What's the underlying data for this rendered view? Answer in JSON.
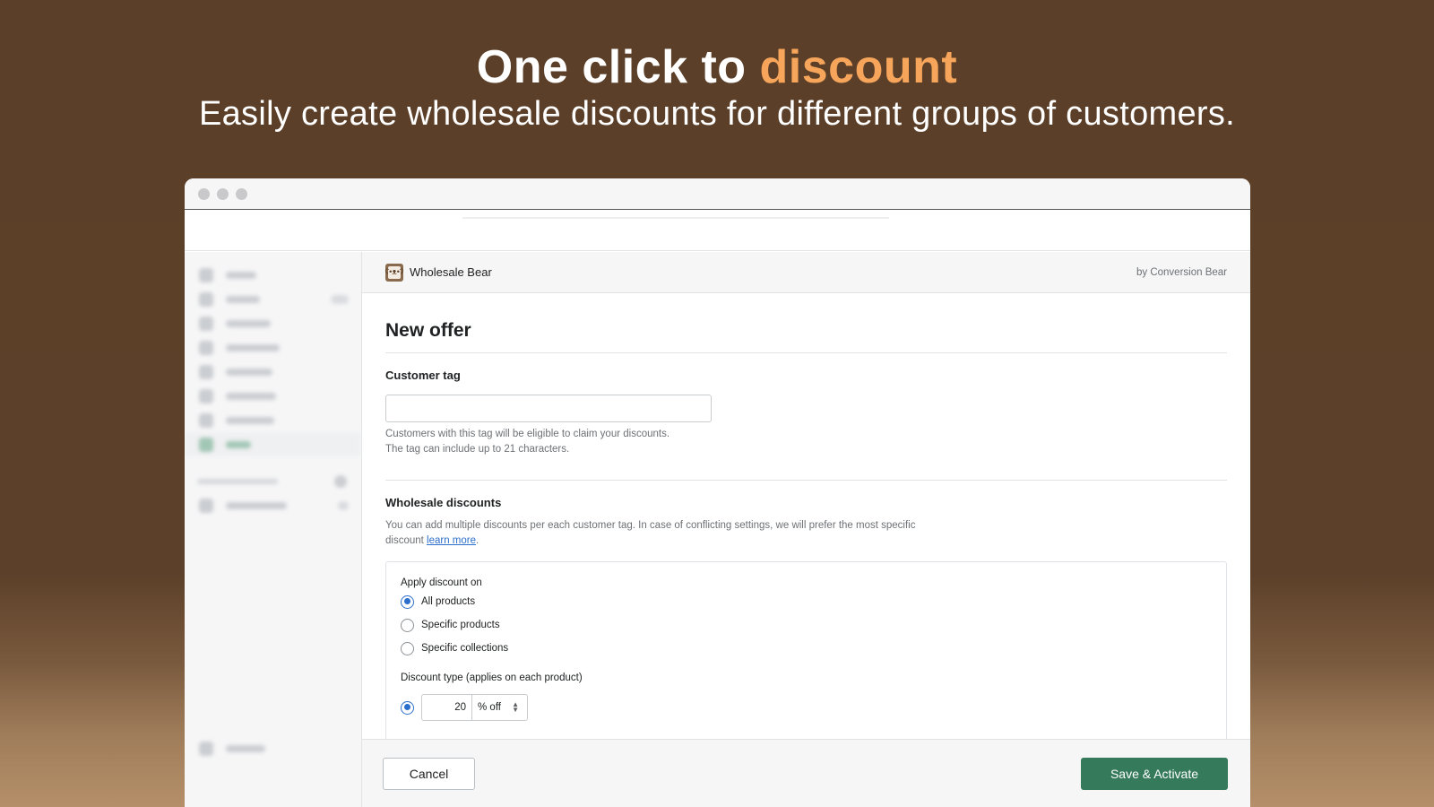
{
  "hero": {
    "title_prefix": "One click to ",
    "title_accent": "discount",
    "subtitle": "Easily create wholesale discounts for different groups of customers."
  },
  "app": {
    "name": "Wholesale Bear",
    "by": "by Conversion Bear"
  },
  "form": {
    "title": "New offer",
    "customer_tag": {
      "label": "Customer tag",
      "value": "",
      "help_line1": "Customers with this tag will be eligible to claim your discounts.",
      "help_line2": "The tag can include up to 21 characters."
    },
    "wholesale": {
      "title": "Wholesale discounts",
      "help": "You can add multiple discounts per each customer tag. In case of conflicting settings, we will prefer the most specific discount ",
      "help_link": "learn more",
      "help_end": ".",
      "apply_label": "Apply discount on",
      "apply_options": [
        {
          "label": "All products",
          "checked": true
        },
        {
          "label": "Specific products",
          "checked": false
        },
        {
          "label": "Specific collections",
          "checked": false
        }
      ],
      "discount_type_label": "Discount type (applies on each product)",
      "discount_value": "20",
      "discount_unit": "% off"
    }
  },
  "footer": {
    "cancel": "Cancel",
    "save": "Save & Activate"
  },
  "colors": {
    "accent": "#f6a55a",
    "primary_button": "#357a5b",
    "radio_checked": "#2c6ecb",
    "background": "#5b3f28"
  }
}
